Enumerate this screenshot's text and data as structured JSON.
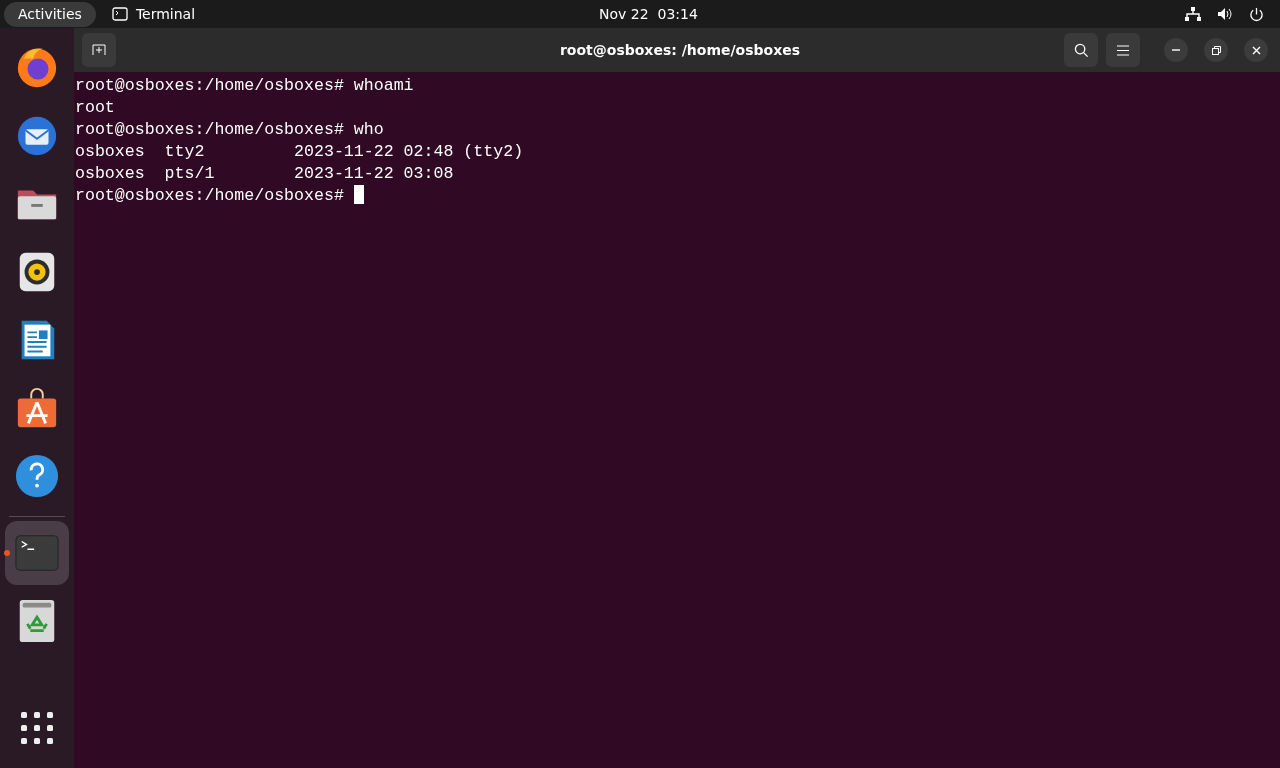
{
  "top_bar": {
    "activities": "Activities",
    "app_name": "Terminal",
    "clock": "Nov 22  03:14"
  },
  "dock": {
    "items": [
      {
        "kind": "firefox",
        "running": false
      },
      {
        "kind": "mail",
        "running": false
      },
      {
        "kind": "files",
        "running": false
      },
      {
        "kind": "music",
        "running": false
      },
      {
        "kind": "writer",
        "running": false
      },
      {
        "kind": "store",
        "running": false
      },
      {
        "kind": "help",
        "running": false
      },
      {
        "kind": "terminal",
        "running": true
      },
      {
        "kind": "trash",
        "running": false
      }
    ]
  },
  "window": {
    "title": "root@osboxes: /home/osboxes"
  },
  "terminal": {
    "lines": [
      "root@osboxes:/home/osboxes# whoami",
      "root",
      "root@osboxes:/home/osboxes# who",
      "osboxes  tty2         2023-11-22 02:48 (tty2)",
      "osboxes  pts/1        2023-11-22 03:08",
      "root@osboxes:/home/osboxes# "
    ]
  }
}
